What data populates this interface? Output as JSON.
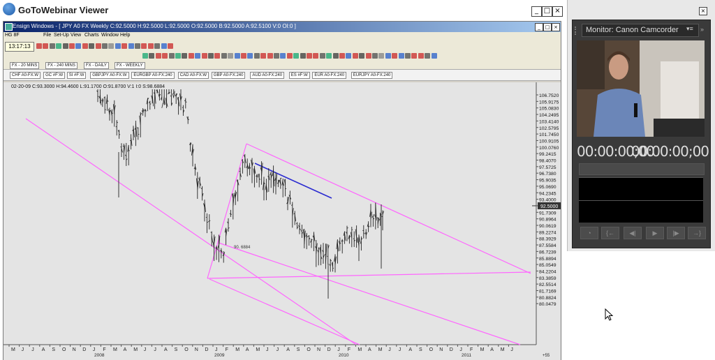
{
  "gtw": {
    "title": "GoToWebinar Viewer",
    "min": "_",
    "max": "□",
    "close": "×"
  },
  "ensign": {
    "title": "Ensign Windows - [ JPY A0 FX Weekly C:92.5000 H:92.5000 L:92.5000 O:92.5000 B:92.5000 A:92.5100 V:0 OI:0 ]",
    "doc_label": "HG 8F",
    "menus": [
      "File",
      "Set-Up",
      "View",
      "Charts",
      "Window",
      "Help"
    ],
    "clock": "13:17:13",
    "tabs_top": [
      "FX - 20 MINS",
      "FX - 240 MINS",
      "FX - DAILY",
      "FX - WEEKLY"
    ],
    "tabs_bottom": [
      "CHF A0-FX:W",
      "GC #F:W",
      "SI #F:W",
      "GBPJPY A0-FX:W",
      "EURGBP A0-FX:240",
      "CAD A0-FX:W",
      "GBP A0-FX:240",
      "AUD A0-FX:240",
      "ES #F:W",
      "EUR A0-FX:240",
      "EURJPY A0-FX:240"
    ]
  },
  "chart_data": {
    "type": "ohlc",
    "info": "02-20-09    C:93.3000    H:94.4600    L:91.1700    O:91.8700    V:1    I:0    S:98.6884",
    "y_ticks": [
      "106.7520",
      "105.9175",
      "105.0830",
      "104.2495",
      "103.4140",
      "102.5795",
      "101.7450",
      "100.9105",
      "100.0760",
      "99.2415",
      "98.4070",
      "97.5725",
      "96.7380",
      "95.9035",
      "95.0690",
      "94.2345",
      "93.4000",
      "92.5000",
      "91.7309",
      "90.8964",
      "90.0619",
      "89.2274",
      "88.3929",
      "87.5584",
      "86.7239",
      "85.8894",
      "85.0549",
      "84.2204",
      "83.3859",
      "82.5514",
      "81.7169",
      "80.8824",
      "80.0479"
    ],
    "last_price": "92.5000",
    "annotation": "90. 6884",
    "months": [
      "M",
      "J",
      "J",
      "A",
      "S",
      "O",
      "N",
      "D",
      "J",
      "F",
      "M",
      "A",
      "M",
      "J",
      "J",
      "A",
      "S",
      "O",
      "N",
      "D",
      "J",
      "F",
      "M",
      "A",
      "M",
      "J",
      "J",
      "A",
      "S",
      "O",
      "N",
      "D",
      "J",
      "F",
      "M",
      "A",
      "M",
      "J",
      "J",
      "A",
      "S",
      "O",
      "N",
      "D",
      "J",
      "F",
      "M",
      "A",
      "M",
      "J"
    ],
    "years": [
      "2008",
      "2009",
      "2010",
      "2011"
    ],
    "corner": "+55",
    "channel_color": "#ff66ff",
    "trend_color": "#2a2ad0"
  },
  "monitor": {
    "tab_label": "Monitor: Canon Camcorder",
    "timecode_in": "00:00:00;00",
    "timecode_out": "00:00:00;00"
  }
}
